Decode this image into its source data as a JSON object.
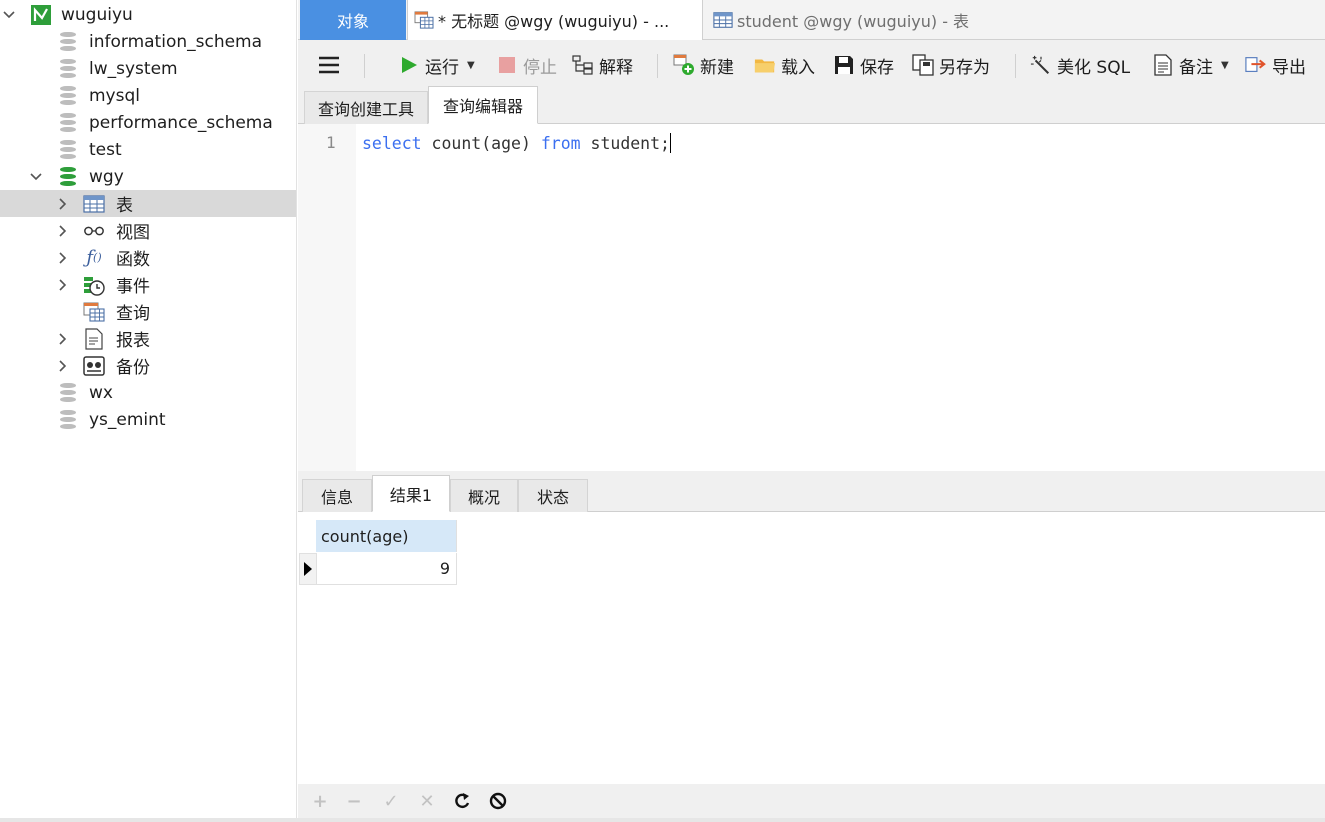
{
  "sidebar": {
    "connection": {
      "label": "wuguiyu"
    },
    "databases": [
      {
        "label": "information_schema"
      },
      {
        "label": "lw_system"
      },
      {
        "label": "mysql"
      },
      {
        "label": "performance_schema"
      },
      {
        "label": "test"
      }
    ],
    "active_db": {
      "label": "wgy",
      "children": [
        {
          "label": "表",
          "icon": "table-icon"
        },
        {
          "label": "视图",
          "icon": "view-icon"
        },
        {
          "label": "函数",
          "icon": "function-icon"
        },
        {
          "label": "事件",
          "icon": "event-icon"
        },
        {
          "label": "查询",
          "icon": "query-icon"
        },
        {
          "label": "报表",
          "icon": "report-icon"
        },
        {
          "label": "备份",
          "icon": "backup-icon"
        }
      ]
    },
    "more_databases": [
      {
        "label": "wx"
      },
      {
        "label": "ys_emint"
      }
    ]
  },
  "doc_tabs": {
    "objects": "对象",
    "query_tab": "* 无标题 @wgy (wuguiyu) - ...",
    "table_tab": "student @wgy (wuguiyu) - 表"
  },
  "toolbar": {
    "run": "运行",
    "stop": "停止",
    "explain": "解释",
    "new": "新建",
    "load": "载入",
    "save": "保存",
    "save_as": "另存为",
    "beautify": "美化 SQL",
    "comment": "备注",
    "export": "导出"
  },
  "editor_tabs": {
    "builder": "查询创建工具",
    "editor": "查询编辑器"
  },
  "editor": {
    "line_number": "1",
    "kw_select": "select",
    "expr": " count(age) ",
    "kw_from": "from",
    "rest": " student;"
  },
  "result_tabs": {
    "info": "信息",
    "result1": "结果1",
    "overview": "概况",
    "status": "状态"
  },
  "result_grid": {
    "column": "count(age)",
    "value": "9"
  },
  "bottom_bar": {
    "add": "+",
    "remove": "−",
    "apply": "✓",
    "discard": "✕"
  },
  "colors": {
    "accent": "#4a90e2",
    "keyword": "#3b6ff0",
    "db_active": "#2e9e3a",
    "header_bg": "#d6e8f8"
  }
}
